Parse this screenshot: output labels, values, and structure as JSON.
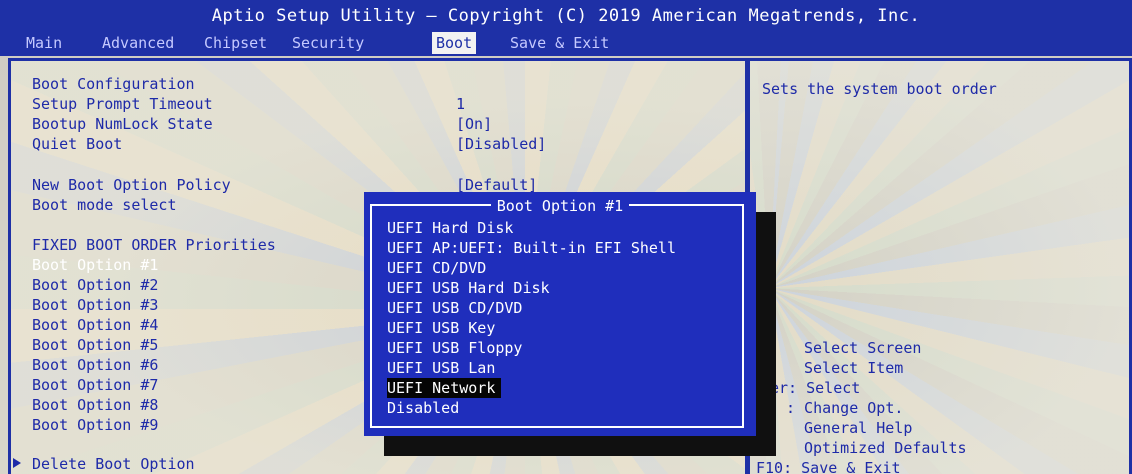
{
  "header": {
    "title": "Aptio Setup Utility – Copyright (C) 2019 American Megatrends, Inc.",
    "tabs": [
      {
        "label": "Main"
      },
      {
        "label": "Advanced"
      },
      {
        "label": "Chipset"
      },
      {
        "label": "Security"
      },
      {
        "label": "Boot",
        "active": true
      },
      {
        "label": "Save & Exit"
      }
    ]
  },
  "settings": {
    "section_title": "Boot Configuration",
    "items": [
      {
        "label": "Setup Prompt Timeout",
        "value": "1"
      },
      {
        "label": "Bootup NumLock State",
        "value": "[On]"
      },
      {
        "label": "Quiet Boot",
        "value": "[Disabled]"
      },
      {
        "label": "New Boot Option Policy",
        "value": "[Default]"
      },
      {
        "label": "Boot mode select",
        "value": ""
      }
    ],
    "priorities_title": "FIXED BOOT ORDER Priorities",
    "boot_options": [
      "Boot Option #1",
      "Boot Option #2",
      "Boot Option #3",
      "Boot Option #4",
      "Boot Option #5",
      "Boot Option #6",
      "Boot Option #7",
      "Boot Option #8",
      "Boot Option #9"
    ],
    "selected_boot_option_index": 0,
    "delete_label": "Delete Boot Option"
  },
  "help": {
    "description": "Sets the system boot order",
    "keys": [
      "Select Screen",
      "Select Item",
      "er: Select",
      ": Change Opt.",
      "General Help",
      "Optimized Defaults",
      "F10: Save & Exit"
    ]
  },
  "popup": {
    "title": "Boot Option #1",
    "options": [
      "UEFI Hard Disk",
      "UEFI AP:UEFI: Built-in EFI Shell",
      "UEFI CD/DVD",
      "UEFI USB Hard Disk",
      "UEFI USB CD/DVD",
      "UEFI USB Key",
      "UEFI USB Floppy",
      "UEFI USB Lan",
      "UEFI Network",
      "Disabled"
    ],
    "highlighted_index": 8
  },
  "colors": {
    "bios_blue": "#1e30a6",
    "text_blue": "#1e2aa8",
    "popup_blue": "#1f2ebc",
    "highlight": "#050505"
  }
}
